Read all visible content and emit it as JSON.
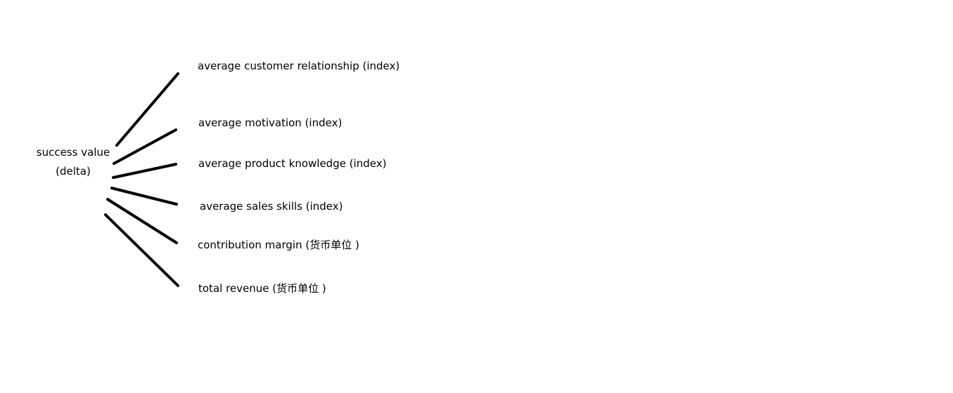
{
  "diagram": {
    "root": {
      "line1": "success value",
      "line2": "(delta)"
    },
    "branches": [
      {
        "label": "average customer relationship (index)"
      },
      {
        "label": "average motivation (index)"
      },
      {
        "label": "average product knowledge (index)"
      },
      {
        "label": "average sales skills (index)"
      },
      {
        "label": "contribution margin (货币单位 )"
      },
      {
        "label": "total revenue (货币单位 )"
      }
    ],
    "line_color": "#000000",
    "background_color": "#ffffff"
  }
}
